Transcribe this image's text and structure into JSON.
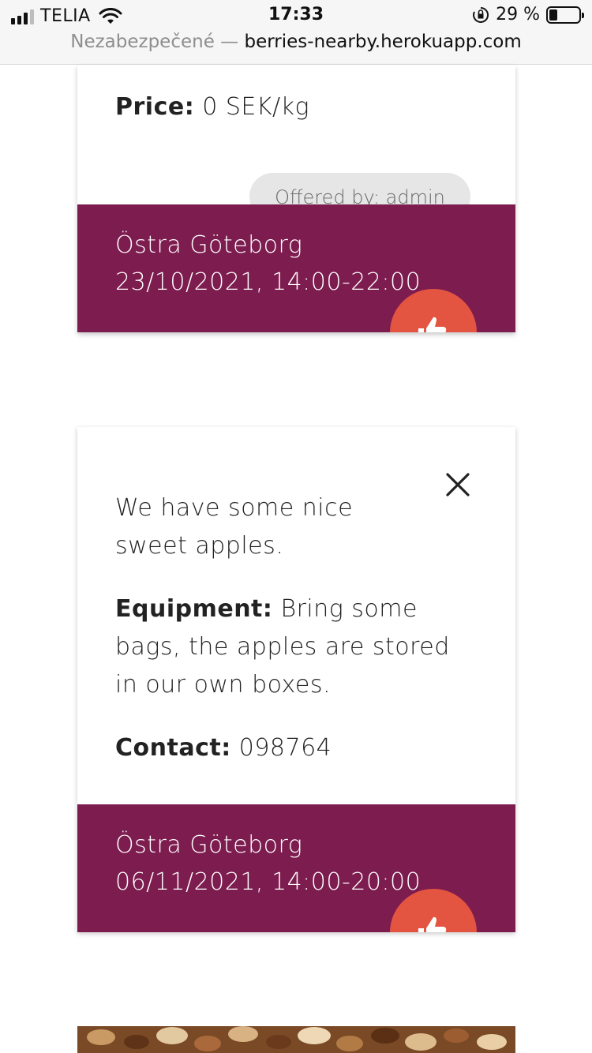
{
  "status_bar": {
    "carrier": "TELIA",
    "time": "17:33",
    "battery_percent": "29 %"
  },
  "url_bar": {
    "security_label": "Nezabezpečené —",
    "host": "berries-nearby.herokuapp.com"
  },
  "cards": [
    {
      "price_label": "Price:",
      "price_value": "0 SEK/kg",
      "offered_by": "Offered by: admin",
      "location": "Östra Göteborg",
      "datetime": "23/10/2021, 14:00-22:00"
    },
    {
      "description": "We have some nice sweet apples.",
      "equipment_label": "Equipment:",
      "equipment_value": "Bring some bags, the apples are stored in our own boxes.",
      "contact_label": "Contact:",
      "contact_value": "098764",
      "location": "Östra Göteborg",
      "datetime": "06/11/2021, 14:00-20:00"
    }
  ],
  "colors": {
    "footer": "#7d1c4f",
    "fab": "#e35441",
    "offered_pill": "#e6e6e6"
  },
  "icons": [
    "wifi-icon",
    "orientation-lock-icon",
    "close-icon",
    "thumbs-up-icon"
  ]
}
